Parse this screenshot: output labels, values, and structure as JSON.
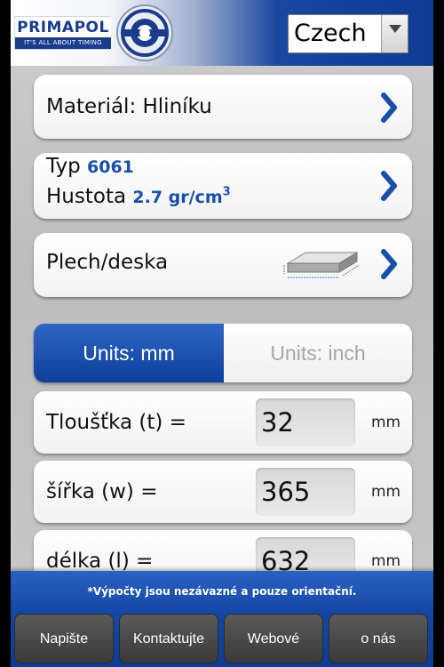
{
  "header": {
    "logo_name": "PRIMAPOL",
    "logo_tagline": "IT'S ALL ABOUT TIMING",
    "language": "Czech"
  },
  "material_row": {
    "label": "Materiál: Hliníku"
  },
  "type_row": {
    "type_label": "Typ",
    "type_value": "6061",
    "density_label": "Hustota",
    "density_value": "2.7 gr/cm",
    "density_exponent": "3"
  },
  "shape_row": {
    "label": "Plech/deska"
  },
  "units": {
    "mm": "Units:  mm",
    "inch": "Units:  inch",
    "selected": "mm"
  },
  "fields": [
    {
      "label": "Tloušťka (t) =",
      "value": "32",
      "unit": "mm"
    },
    {
      "label": "šířka (w) =",
      "value": "365",
      "unit": "mm"
    },
    {
      "label": "délka (l) =",
      "value": "632",
      "unit": "mm"
    }
  ],
  "footer": {
    "disclaimer": "*Výpočty jsou nezávazné a pouze orientační.",
    "buttons": [
      "Napište",
      "Kontaktujte",
      "Webové",
      "o nás"
    ]
  },
  "colors": {
    "accent": "#1a4fa8",
    "header_blue": "#0d3a94",
    "selected_tab": "#0d3f9c"
  }
}
